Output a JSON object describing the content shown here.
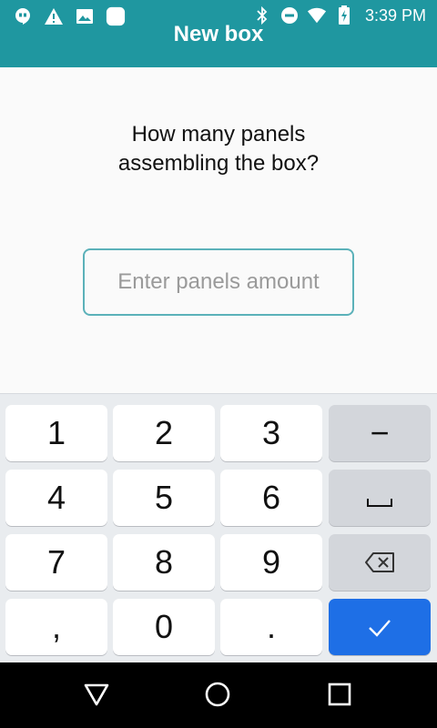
{
  "status_bar": {
    "time": "3:39 PM",
    "left_icons": [
      "hangouts-icon",
      "warning-icon",
      "image-icon",
      "app-square-icon"
    ],
    "right_icons": [
      "bluetooth-icon",
      "do-not-disturb-icon",
      "wifi-icon",
      "battery-icon"
    ]
  },
  "app_bar": {
    "title": "New box",
    "color": "#1f97a0"
  },
  "question": {
    "line1": "How many panels",
    "line2": "assembling the box?"
  },
  "panels_input": {
    "value": "",
    "placeholder": "Enter panels amount"
  },
  "keyboard": {
    "digits": {
      "k1": "1",
      "k2": "2",
      "k3": "3",
      "k4": "4",
      "k5": "5",
      "k6": "6",
      "k7": "7",
      "k8": "8",
      "k9": "9",
      "k0": "0"
    },
    "comma": ",",
    "dot": ".",
    "minus": "−",
    "space_icon": "space-bar-icon",
    "backspace_icon": "backspace-icon",
    "done_icon": "checkmark-icon",
    "accent": "#1e6fe6"
  },
  "nav_bar": {
    "buttons": [
      "back-triangle-icon",
      "home-circle-icon",
      "recents-square-icon"
    ]
  }
}
